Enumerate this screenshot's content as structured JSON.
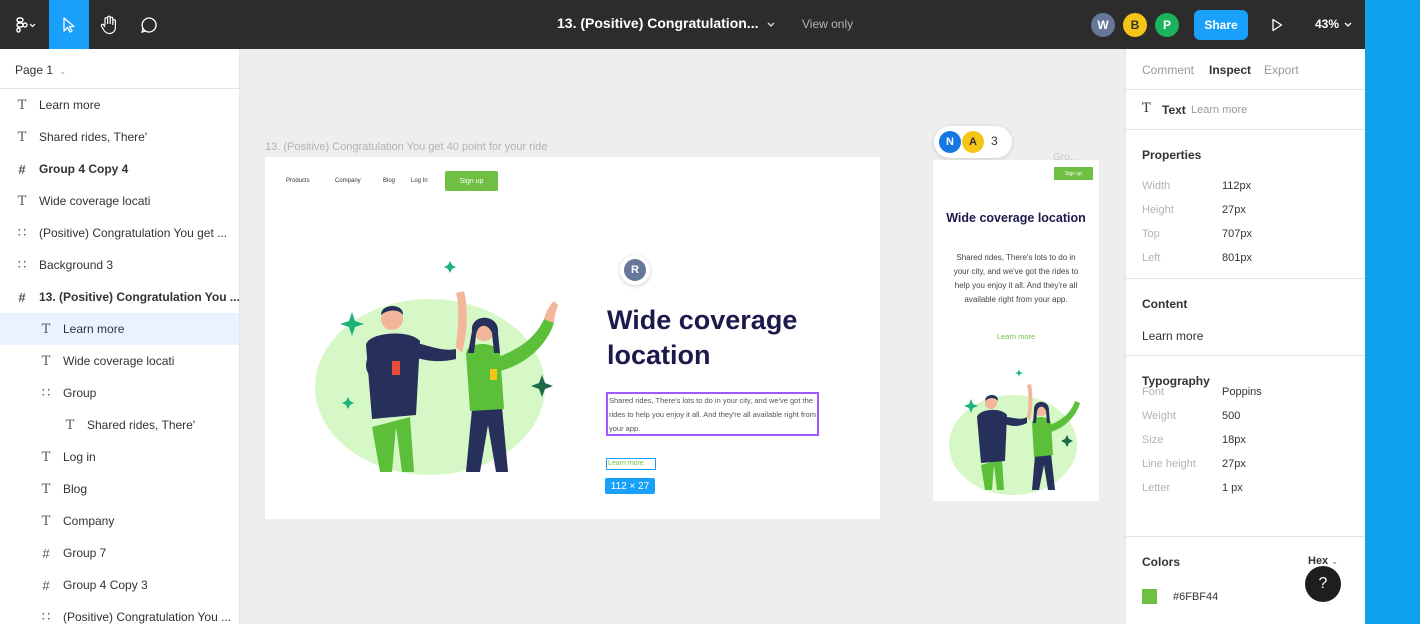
{
  "toolbar": {
    "title": "13. (Positive) Congratulation...",
    "view_only": "View only",
    "share_label": "Share",
    "zoom": "43%",
    "avatars": [
      {
        "initial": "W",
        "color": "#667799"
      },
      {
        "initial": "B",
        "color": "#f5c518"
      },
      {
        "initial": "P",
        "color": "#1bb35b"
      }
    ],
    "accent": "#18a0fb",
    "bg": "#2c2c2c"
  },
  "left_panel": {
    "page": "Page 1",
    "layers": [
      {
        "label": "Learn more",
        "icon": "text-icon",
        "indent": 0,
        "bold": false,
        "selected": false
      },
      {
        "label": "Shared rides, There'",
        "icon": "text-icon",
        "indent": 0,
        "bold": false,
        "selected": false
      },
      {
        "label": "Group 4 Copy 4",
        "icon": "frame-icon",
        "indent": 0,
        "bold": true,
        "selected": false
      },
      {
        "label": "Wide coverage locati",
        "icon": "text-icon",
        "indent": 0,
        "bold": false,
        "selected": false
      },
      {
        "label": "(Positive) Congratulation You get ...",
        "icon": "group-icon",
        "indent": 0,
        "bold": false,
        "selected": false
      },
      {
        "label": "Background 3",
        "icon": "group-icon",
        "indent": 0,
        "bold": false,
        "selected": false
      },
      {
        "label": "13. (Positive) Congratulation You ...",
        "icon": "frame-icon",
        "indent": 0,
        "bold": true,
        "selected": false
      },
      {
        "label": "Learn more",
        "icon": "text-icon",
        "indent": 1,
        "bold": false,
        "selected": true
      },
      {
        "label": "Wide coverage locati",
        "icon": "text-icon",
        "indent": 1,
        "bold": false,
        "selected": false
      },
      {
        "label": "Group",
        "icon": "group-icon",
        "indent": 1,
        "bold": false,
        "selected": false
      },
      {
        "label": "Shared rides, There'",
        "icon": "text-icon",
        "indent": 2,
        "bold": false,
        "selected": false
      },
      {
        "label": "Log in",
        "icon": "text-icon",
        "indent": 1,
        "bold": false,
        "selected": false
      },
      {
        "label": "Blog",
        "icon": "text-icon",
        "indent": 1,
        "bold": false,
        "selected": false
      },
      {
        "label": "Company",
        "icon": "text-icon",
        "indent": 1,
        "bold": false,
        "selected": false
      },
      {
        "label": "Group 7",
        "icon": "frame-icon",
        "indent": 1,
        "bold": false,
        "selected": false
      },
      {
        "label": "Group 4 Copy 3",
        "icon": "frame-icon",
        "indent": 1,
        "bold": false,
        "selected": false
      },
      {
        "label": "(Positive) Congratulation You ...",
        "icon": "group-icon",
        "indent": 1,
        "bold": false,
        "selected": false
      }
    ]
  },
  "canvas": {
    "frame_label": "13. (Positive) Congratulation You get 40 point for your ride",
    "nav": [
      "Products",
      "Company",
      "Blog",
      "Log In"
    ],
    "signup": "Sign up",
    "hero_title": "Wide coverage location",
    "hero_body": "Shared rides, There's lots to do in your city, and we've got the rides to help you enjoy it all. And they're all available right from your app.",
    "learn_more": "Learn more",
    "dimensions": "112 × 27",
    "cursor_initial": "R",
    "collaborators": [
      {
        "initial": "N",
        "color": "#1478e0"
      },
      {
        "initial": "A",
        "color": "#f5c518"
      }
    ],
    "collaborator_count": "3",
    "mobile_label": "Gro...",
    "mobile_signup": "Sign up",
    "mobile_title": "Wide coverage location",
    "mobile_body": "Shared rides, There's lots to do in your city, and we've got the rides to help you enjoy it all. And they're all available right from your app.",
    "mobile_learn": "Learn more"
  },
  "right_panel": {
    "tabs": [
      "Comment",
      "Inspect",
      "Export"
    ],
    "active_tab": "Inspect",
    "layer_type": "Text",
    "layer_name": "Learn more",
    "properties_title": "Properties",
    "properties": [
      {
        "k": "Width",
        "v": "112px"
      },
      {
        "k": "Height",
        "v": "27px"
      },
      {
        "k": "Top",
        "v": "707px"
      },
      {
        "k": "Left",
        "v": "801px"
      }
    ],
    "content_title": "Content",
    "content_value": "Learn more",
    "typography_title": "Typography",
    "typography": [
      {
        "k": "Font",
        "v": "Poppins"
      },
      {
        "k": "Weight",
        "v": "500"
      },
      {
        "k": "Size",
        "v": "18px"
      },
      {
        "k": "Line height",
        "v": "27px"
      },
      {
        "k": "Letter",
        "v": "1 px"
      }
    ],
    "colors_title": "Colors",
    "color_format": "Hex",
    "color_value": "#6FBF44",
    "help": "?"
  }
}
